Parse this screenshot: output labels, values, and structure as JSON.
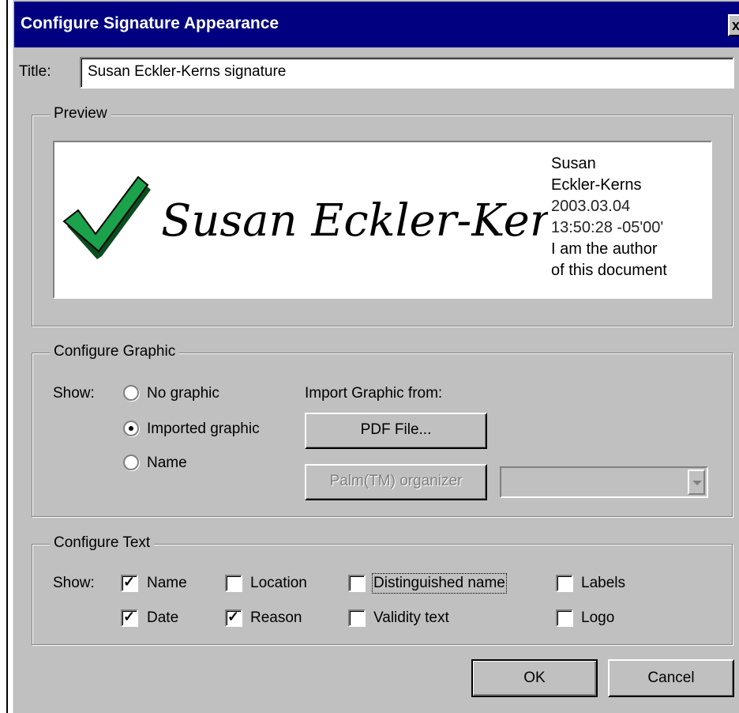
{
  "dialog": {
    "title": "Configure Signature Appearance",
    "close_glyph": "x"
  },
  "title_field": {
    "label": "Title:",
    "value": "Susan Eckler-Kerns signature"
  },
  "preview": {
    "legend": "Preview",
    "signature_script": "Susan Eckler-Kerns",
    "lines": [
      "Susan",
      "Eckler-Kerns",
      "2003.03.04",
      "13:50:28 -05'00'",
      "I am the author",
      "of this document"
    ],
    "check_color": "#1aa34a"
  },
  "configure_graphic": {
    "legend": "Configure Graphic",
    "show_label": "Show:",
    "options": [
      {
        "label": "No graphic",
        "selected": false
      },
      {
        "label": "Imported graphic",
        "selected": true
      },
      {
        "label": "Name",
        "selected": false
      }
    ],
    "import_label": "Import Graphic from:",
    "pdf_button": "PDF File...",
    "palm_button": "Palm(TM) organizer",
    "combo_value": ""
  },
  "configure_text": {
    "legend": "Configure Text",
    "show_label": "Show:",
    "items": [
      {
        "label": "Name",
        "checked": true
      },
      {
        "label": "Location",
        "checked": false
      },
      {
        "label": "Distinguished name",
        "checked": false
      },
      {
        "label": "Labels",
        "checked": false
      },
      {
        "label": "Date",
        "checked": true
      },
      {
        "label": "Reason",
        "checked": true
      },
      {
        "label": "Validity text",
        "checked": false
      },
      {
        "label": "Logo",
        "checked": false
      }
    ]
  },
  "buttons": {
    "ok": "OK",
    "cancel": "Cancel"
  }
}
